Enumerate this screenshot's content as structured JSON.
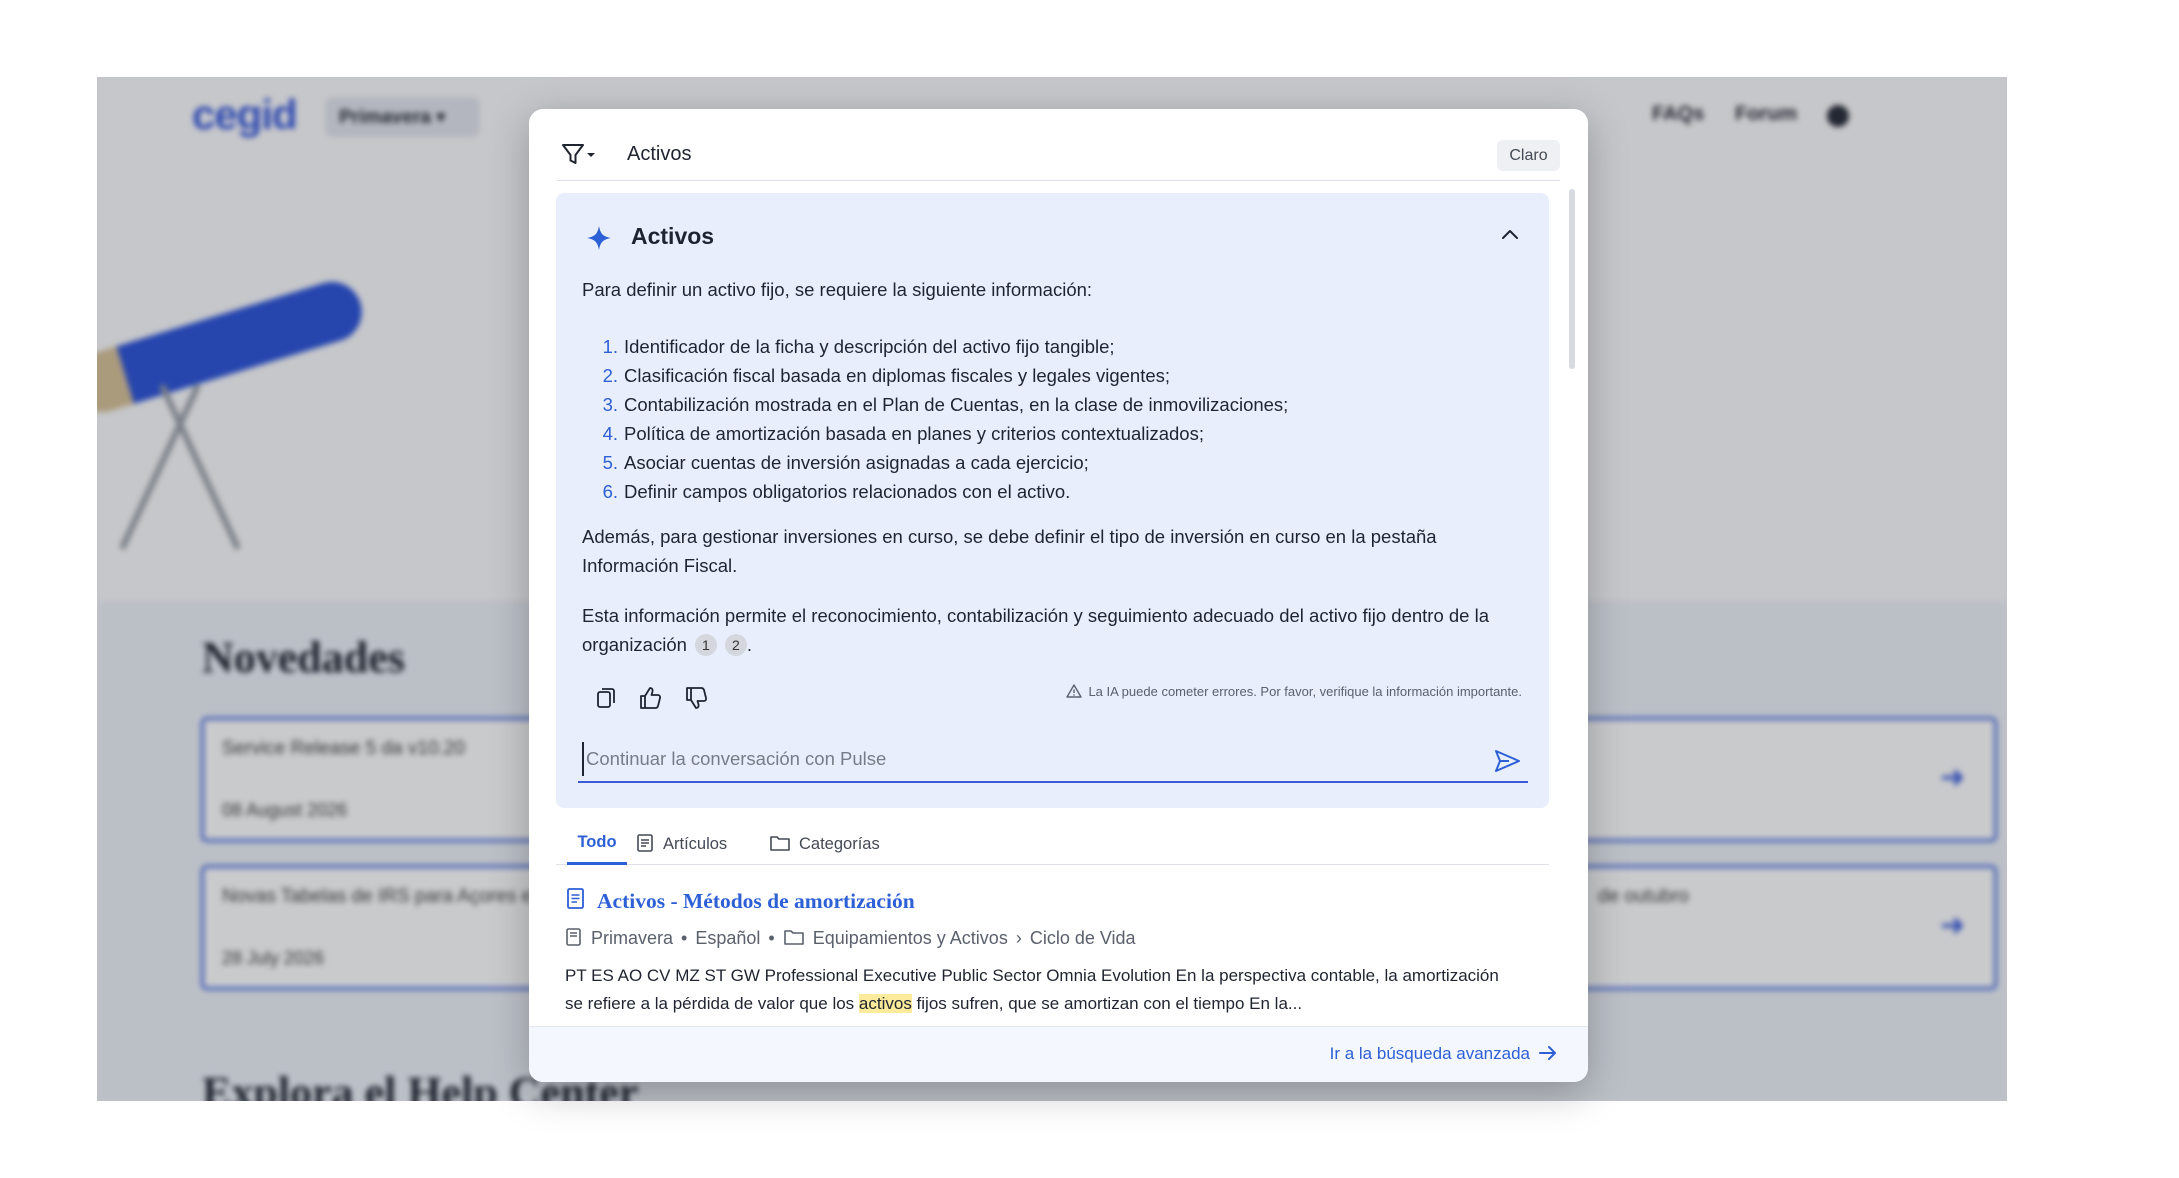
{
  "background": {
    "logo": "cegid",
    "product_selector": "Primavera",
    "nav_links": [
      "FAQs",
      "Forum"
    ],
    "section_news": "Novedades",
    "news_cards": [
      {
        "title": "Service Release 5 da v10.20",
        "date": "08 August 2026"
      },
      {
        "title": "Novas Tabelas de IRS para Açores e",
        "date": "28 July 2026"
      }
    ],
    "card_right_2": "de outubro",
    "section_explore": "Explora el Help Center"
  },
  "search": {
    "query": "Activos",
    "clear_label": "Claro",
    "filter_icon": "filter-icon"
  },
  "ai_answer": {
    "title": "Activos",
    "intro": "Para definir un activo fijo, se requiere la siguiente información:",
    "items": [
      {
        "num": "1.",
        "text": "Identificador de la ficha y descripción del activo fijo tangible;"
      },
      {
        "num": "2.",
        "text": "Clasificación fiscal basada en diplomas fiscales y legales vigentes;"
      },
      {
        "num": "3.",
        "text": "Contabilización mostrada en el Plan de Cuentas, en la clase de inmovilizaciones;"
      },
      {
        "num": "4.",
        "text": "Política de amortización basada en planes y criterios contextualizados;"
      },
      {
        "num": "5.",
        "text": "Asociar cuentas de inversión asignadas a cada ejercicio;"
      },
      {
        "num": "6.",
        "text": "Definir campos obligatorios relacionados con el activo."
      }
    ],
    "paragraph_2": "Además, para gestionar inversiones en curso, se debe definir el tipo de inversión en curso en la pestaña Información Fiscal.",
    "paragraph_3": "Esta información permite el reconocimiento, contabilización y seguimiento adecuado del activo fijo dentro de la organización",
    "citations": [
      "1",
      "2"
    ],
    "paragraph_3_end": ".",
    "disclaimer": "La IA puede cometer errores. Por favor, verifique la información importante.",
    "chat_placeholder": "Continuar la conversación con Pulse"
  },
  "tabs": [
    {
      "label": "Todo",
      "active": true
    },
    {
      "label": "Artículos",
      "active": false
    },
    {
      "label": "Categorías",
      "active": false
    }
  ],
  "results": [
    {
      "title": "Activos - Métodos de amortización",
      "product": "Primavera",
      "language": "Español",
      "category": "Equipamientos y Activos",
      "subcategory": "Ciclo de Vida",
      "snippet_before": "PT ES AO CV MZ ST GW Professional Executive Public Sector Omnia Evolution En la perspectiva contable, la amortización se refiere a la pérdida de valor que los ",
      "snippet_highlight": "activos",
      "snippet_after": " fijos sufren, que se amortizan con el tiempo En la..."
    }
  ],
  "footer": {
    "advanced_link": "Ir a la búsqueda avanzada"
  },
  "colors": {
    "accent": "#2d5fd6",
    "ai_panel_bg": "#e8eefc",
    "highlight": "#fbeb9a"
  }
}
